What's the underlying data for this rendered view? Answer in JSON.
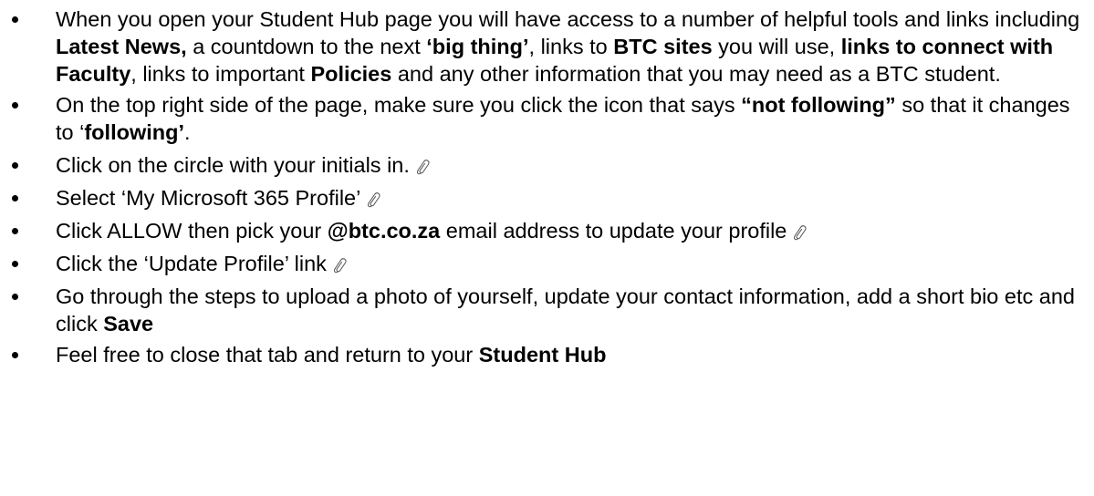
{
  "items": [
    {
      "segments": [
        {
          "text": "When you open your Student Hub page you will have access to a number of helpful tools and links including ",
          "bold": false
        },
        {
          "text": "Latest News,",
          "bold": true
        },
        {
          "text": " a countdown to the next ",
          "bold": false
        },
        {
          "text": "‘big thing’",
          "bold": true
        },
        {
          "text": ", links to ",
          "bold": false
        },
        {
          "text": "BTC sites",
          "bold": true
        },
        {
          "text": " you will use, ",
          "bold": false
        },
        {
          "text": "links to connect with Faculty",
          "bold": true
        },
        {
          "text": ", links to important ",
          "bold": false
        },
        {
          "text": "Policies",
          "bold": true
        },
        {
          "text": " and any other information that you may need as a BTC student.",
          "bold": false
        }
      ],
      "link_icon": false
    },
    {
      "segments": [
        {
          "text": "On the top right side of the page, make sure you click the icon that says ",
          "bold": false
        },
        {
          "text": "“not following”",
          "bold": true
        },
        {
          "text": "  so that it changes to ‘",
          "bold": false
        },
        {
          "text": "following’",
          "bold": true
        },
        {
          "text": ".",
          "bold": false
        }
      ],
      "link_icon": false
    },
    {
      "segments": [
        {
          "text": "Click on the circle with your initials in.",
          "bold": false
        }
      ],
      "link_icon": true
    },
    {
      "segments": [
        {
          "text": "Select ‘My Microsoft 365 Profile’",
          "bold": false
        }
      ],
      "link_icon": true
    },
    {
      "segments": [
        {
          "text": "Click ALLOW then pick your ",
          "bold": false
        },
        {
          "text": "@btc.co.za",
          "bold": true
        },
        {
          "text": " email address to update your profile",
          "bold": false
        }
      ],
      "link_icon": true
    },
    {
      "segments": [
        {
          "text": "Click the ‘Update Profile’ link",
          "bold": false
        }
      ],
      "link_icon": true
    },
    {
      "segments": [
        {
          "text": "Go through the steps to upload a photo of yourself, update your contact information, add a short bio etc and click ",
          "bold": false
        },
        {
          "text": "Save",
          "bold": true
        }
      ],
      "link_icon": false
    },
    {
      "segments": [
        {
          "text": "Feel free to close that tab and return to your ",
          "bold": false
        },
        {
          "text": "Student Hub",
          "bold": true
        }
      ],
      "link_icon": false
    }
  ],
  "icons": {
    "link": "link-icon"
  }
}
